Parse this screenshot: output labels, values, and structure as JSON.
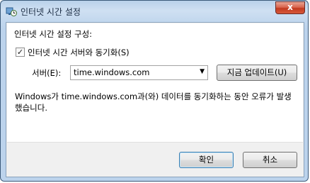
{
  "window": {
    "title": "인터넷 시간 설정",
    "close_glyph": "x"
  },
  "panel": {
    "heading": "인터넷 시간 설정 구성:",
    "sync_checkbox": {
      "label": "인터넷 시간 서버와 동기화(S)",
      "checked": true,
      "glyph": "✓"
    },
    "server": {
      "label": "서버(E):",
      "value": "time.windows.com",
      "arrow": "▼"
    },
    "update_button": "지금 업데이트(U)",
    "message": "Windows가 time.windows.com과(와) 데이터를 동기화하는 동안 오류가 발생했습니다."
  },
  "footer": {
    "ok_button": "확인",
    "cancel_button": "취소"
  },
  "colors": {
    "title_bar": "#c3d8ee",
    "close_button": "#c23a20",
    "panel_bg": "#ffffff",
    "footer_bg": "#f0f0f0"
  }
}
